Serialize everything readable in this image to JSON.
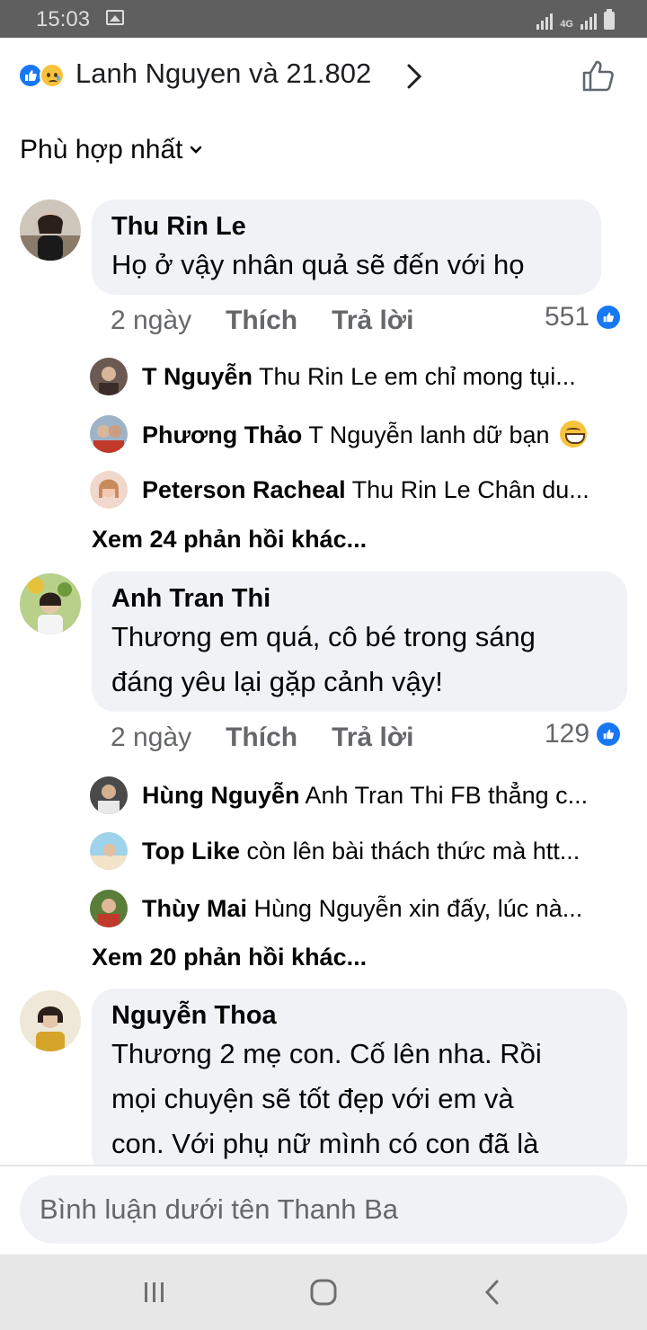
{
  "status_bar": {
    "time": "15:03",
    "network": "4G"
  },
  "reactions": {
    "summary": "Lanh Nguyen và 21.802"
  },
  "sort": {
    "label": "Phù hợp nhất"
  },
  "comments": [
    {
      "author": "Thu Rin Le",
      "text_lines": [
        "Họ ở vậy nhân quả sẽ đến với họ"
      ],
      "time": "2 ngày",
      "like_label": "Thích",
      "reply_label": "Trả lời",
      "like_count": "551",
      "replies": [
        {
          "name": "T Nguyễn",
          "text": "Thu Rin Le em chỉ mong tụi..."
        },
        {
          "name": "Phương Thảo",
          "text": "T Nguyễn lanh dữ bạn"
        },
        {
          "name": "Peterson Racheal",
          "text": "Thu Rin Le Chân du..."
        }
      ],
      "more_replies": "Xem 24 phản hồi khác..."
    },
    {
      "author": "Anh Tran Thi",
      "text_lines": [
        "Thương em quá, cô bé trong sáng",
        "đáng yêu lại gặp cảnh vậy!"
      ],
      "time": "2 ngày",
      "like_label": "Thích",
      "reply_label": "Trả lời",
      "like_count": "129",
      "replies": [
        {
          "name": "Hùng Nguyễn",
          "text": "Anh Tran Thi FB thẳng c..."
        },
        {
          "name": "Top Like",
          "text": "còn lên bài thách thức mà htt..."
        },
        {
          "name": "Thùy Mai",
          "text": "Hùng Nguyễn xin đấy,  lúc nà..."
        }
      ],
      "more_replies": "Xem 20 phản hồi khác..."
    },
    {
      "author": "Nguyễn Thoa",
      "text_lines": [
        "Thương 2 mẹ con. Cố lên nha. Rồi",
        "mọi chuyện sẽ tốt đẹp với em và",
        "con. Với phụ nữ mình có con đã là"
      ]
    }
  ],
  "composer": {
    "placeholder": "Bình luận dưới tên Thanh Ba"
  },
  "colors": {
    "accent": "#1877f2",
    "bubble": "#f0f2f5",
    "muted_text": "#65676b"
  }
}
